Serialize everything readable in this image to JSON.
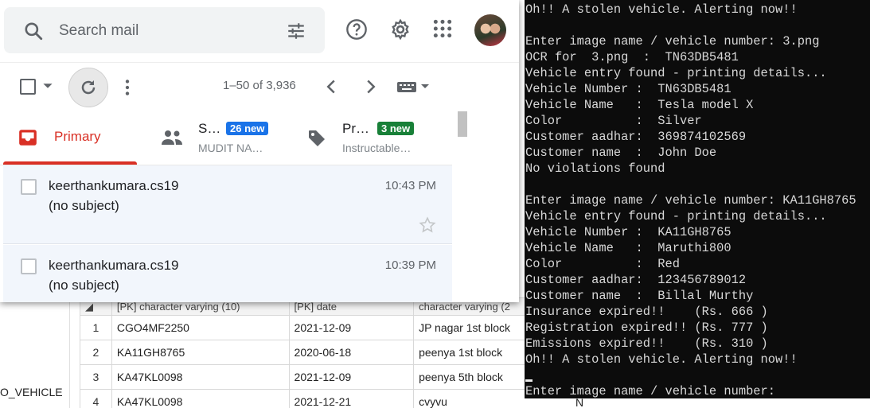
{
  "gmail": {
    "search_placeholder": "Search mail",
    "pagination": "1–50 of 3,936",
    "tabs": [
      {
        "title": "Primary"
      },
      {
        "title": "S…",
        "badge": "26 new",
        "badge_color": "#1a73e8",
        "sub": "MUDIT NA…"
      },
      {
        "title": "Pr…",
        "badge": "3 new",
        "badge_color": "#188038",
        "sub": "Instructable…"
      }
    ],
    "emails": [
      {
        "sender": "keerthankumara.cs19",
        "subject": "(no subject)",
        "time": "10:43 PM"
      },
      {
        "sender": "keerthankumara.cs19",
        "subject": "(no subject)",
        "time": "10:39 PM"
      }
    ],
    "accent_red": "#d93025"
  },
  "db": {
    "side_label": "O_VEHICLE",
    "headers": [
      "[PK] character varying (10)",
      "[PK] date",
      "character varying (2"
    ],
    "rows": [
      {
        "num": "1",
        "vehicle": "CGO4MF2250",
        "date": "2021-12-09",
        "location": "JP nagar 1st block"
      },
      {
        "num": "2",
        "vehicle": "KA11GH8765",
        "date": "2020-06-18",
        "location": "peenya 1st block"
      },
      {
        "num": "3",
        "vehicle": "KA47KL0098",
        "date": "2021-12-09",
        "location": "peenya 5th block"
      },
      {
        "num": "4",
        "vehicle": "KA47KL0098",
        "date": "2021-12-21",
        "location": "cvyvu"
      }
    ],
    "trailing_cell": "N"
  },
  "terminal": {
    "lines": [
      "Oh!! A stolen vehicle. Alerting now!!",
      "",
      "Enter image name / vehicle number: 3.png",
      "OCR for  3.png  :  TN63DB5481",
      "Vehicle entry found - printing details...",
      "Vehicle Number :  TN63DB5481",
      "Vehicle Name   :  Tesla model X",
      "Color          :  Silver",
      "Customer aadhar:  369874102569",
      "Customer name  :  John Doe",
      "No violations found",
      "",
      "Enter image name / vehicle number: KA11GH8765",
      "Vehicle entry found - printing details...",
      "Vehicle Number :  KA11GH8765",
      "Vehicle Name   :  Maruthi800",
      "Color          :  Red",
      "Customer aadhar:  123456789012",
      "Customer name  :  Billal Murthy",
      "Insurance expired!!    (Rs. 666 )",
      "Registration expired!! (Rs. 777 )",
      "Emissions expired!!    (Rs. 310 )",
      "Oh!! A stolen vehicle. Alerting now!!",
      "",
      "Enter image name / vehicle number: "
    ]
  }
}
